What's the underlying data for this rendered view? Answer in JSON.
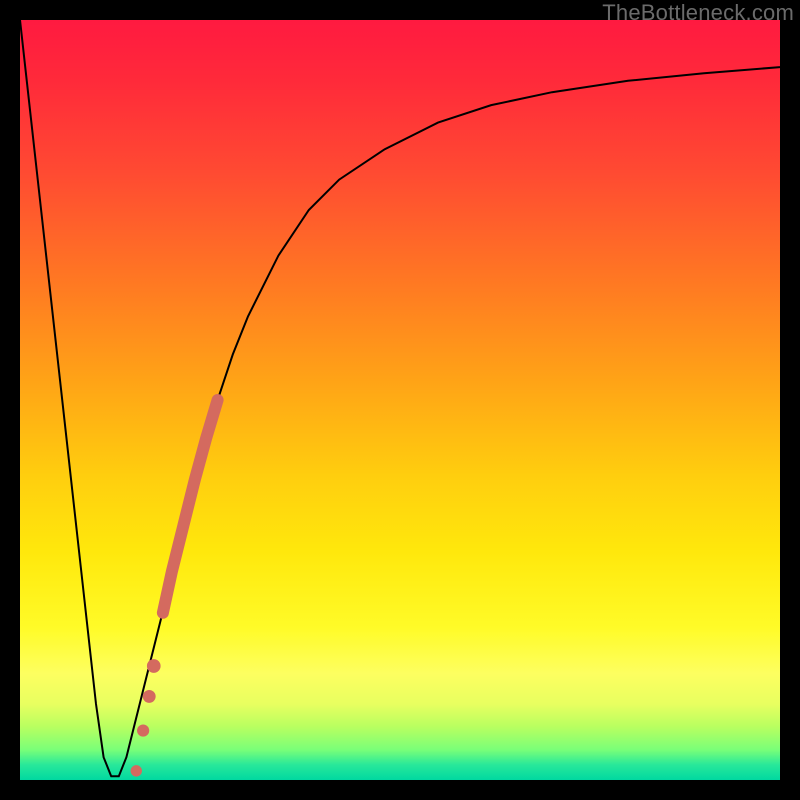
{
  "watermark": "TheBottleneck.com",
  "chart_data": {
    "type": "line",
    "title": "",
    "xlabel": "",
    "ylabel": "",
    "xlim": [
      0,
      100
    ],
    "ylim": [
      0,
      100
    ],
    "grid": false,
    "series": [
      {
        "name": "curve",
        "x": [
          0,
          2,
          4,
          6,
          8,
          10,
          11,
          12,
          13,
          14,
          16,
          18,
          20,
          22,
          24,
          26,
          28,
          30,
          34,
          38,
          42,
          48,
          55,
          62,
          70,
          80,
          90,
          100
        ],
        "y": [
          100,
          82,
          64,
          46,
          28,
          10,
          3,
          0.5,
          0.5,
          3,
          11,
          19,
          27,
          35,
          43,
          50,
          56,
          61,
          69,
          75,
          79,
          83,
          86.5,
          88.8,
          90.5,
          92,
          93,
          93.8
        ],
        "stroke": "#000000",
        "stroke_width": 2
      }
    ],
    "highlight_segment": {
      "name": "thick-highlight",
      "color": "#d46a5f",
      "points_xy": [
        [
          18.8,
          22.0
        ],
        [
          20.0,
          27.5
        ],
        [
          21.5,
          33.5
        ],
        [
          23.0,
          39.5
        ],
        [
          24.5,
          45.0
        ],
        [
          26.0,
          50.0
        ]
      ],
      "dots_xy": [
        [
          17.6,
          15.0
        ],
        [
          17.0,
          11.0
        ],
        [
          16.2,
          6.5
        ],
        [
          15.3,
          1.2
        ]
      ]
    },
    "background_gradient": {
      "direction": "top-to-bottom",
      "stops": [
        {
          "pos": 0.0,
          "color": "#ff1a40"
        },
        {
          "pos": 0.35,
          "color": "#ff7a22"
        },
        {
          "pos": 0.6,
          "color": "#ffce0e"
        },
        {
          "pos": 0.82,
          "color": "#fffb28"
        },
        {
          "pos": 0.95,
          "color": "#9bff60"
        },
        {
          "pos": 1.0,
          "color": "#00d8a0"
        }
      ]
    }
  }
}
